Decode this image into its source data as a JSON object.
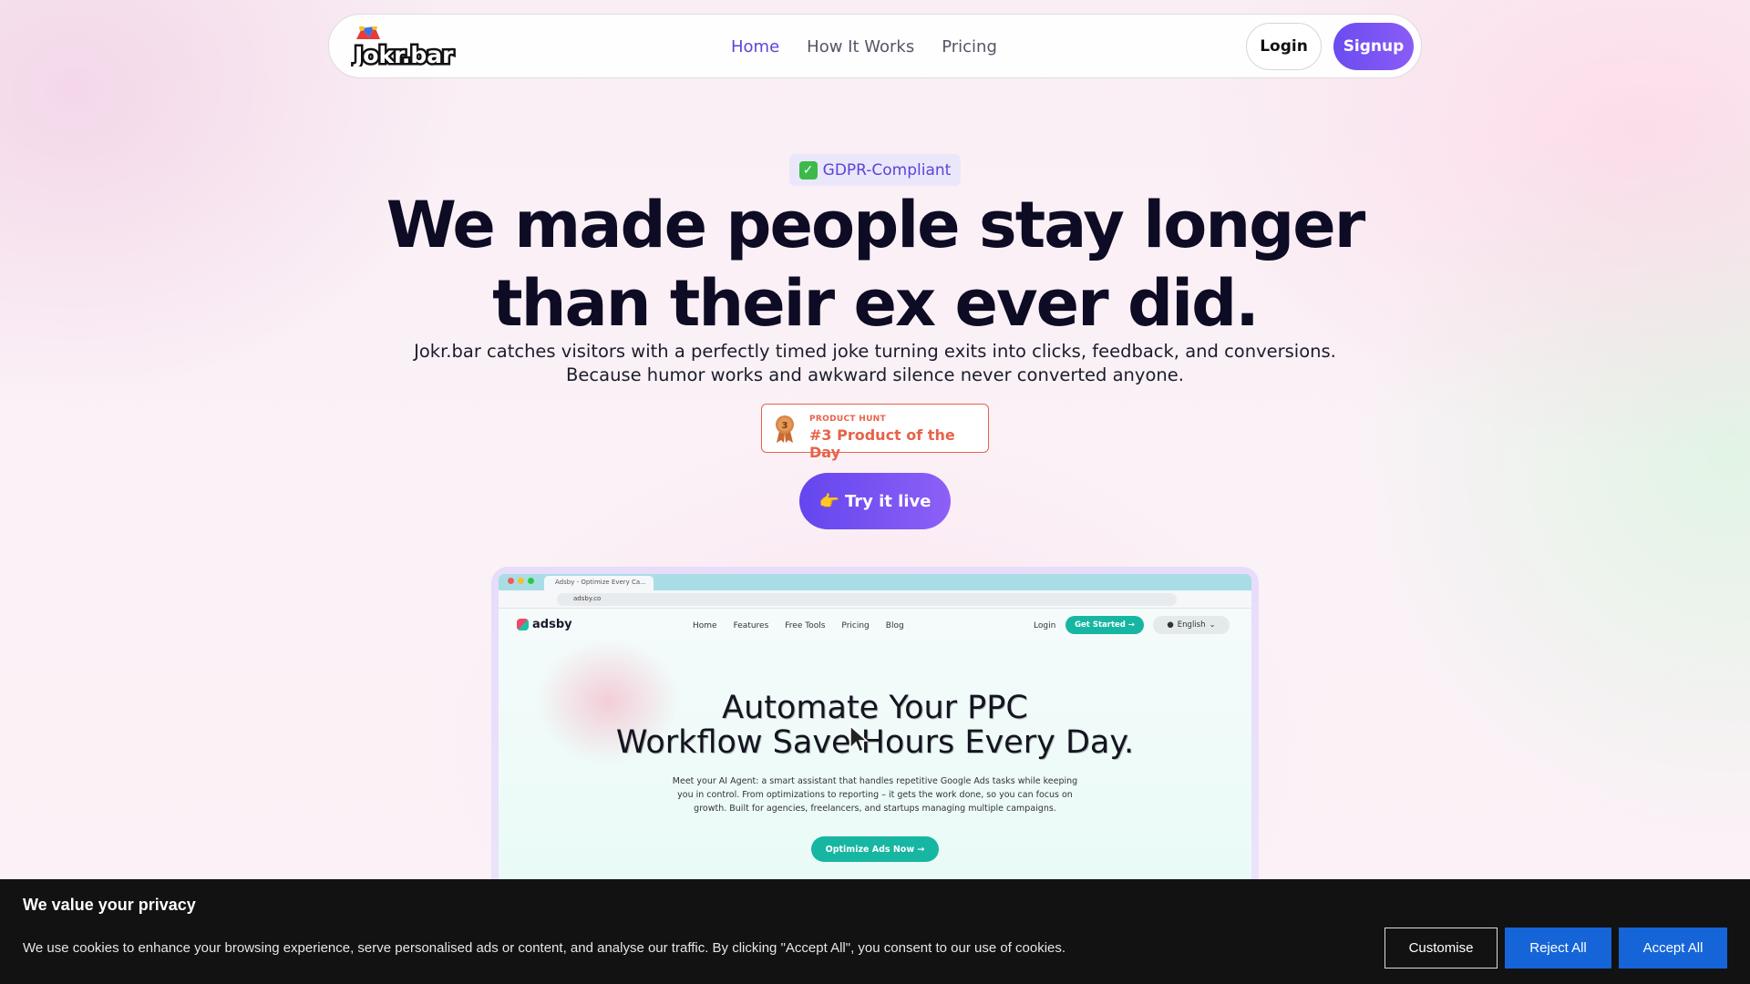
{
  "nav": {
    "logo_text": "Jokr.bar",
    "links": [
      "Home",
      "How It Works",
      "Pricing"
    ],
    "active": "Home",
    "login": "Login",
    "signup": "Signup"
  },
  "hero": {
    "badge": "GDPR-Compliant",
    "headline_line1": "We made people stay longer",
    "headline_line2": "than their ex ever did.",
    "sub_line1": "Jokr.bar catches visitors with a perfectly timed joke turning exits into clicks, feedback, and conversions.",
    "sub_line2": "Because humor works and awkward silence never converted anyone.",
    "product_hunt_small": "PRODUCT HUNT",
    "product_hunt_big": "#3 Product of the Day",
    "product_hunt_rank": "3",
    "cta_emoji": "👉",
    "cta": "Try it live"
  },
  "preview": {
    "tab_title": "Adsby - Optimize Every Ca...",
    "url": "adsby.co",
    "logo": "adsby",
    "links": [
      "Home",
      "Features",
      "Free Tools",
      "Pricing",
      "Blog"
    ],
    "login": "Login",
    "get_started": "Get Started →",
    "language": "English",
    "title_line1": "Automate Your PPC",
    "title_line2": "Workflow Save Hours Every Day.",
    "body": "Meet your AI Agent: a smart assistant that handles repetitive Google Ads tasks while keeping you in control. From optimizations to reporting – it gets the work done, so you can focus on growth. Built for agencies, freelancers, and startups managing multiple campaigns.",
    "cta": "Optimize Ads Now →"
  },
  "cookie": {
    "title": "We value your privacy",
    "text": "We use cookies to enhance your browsing experience, serve personalised ads or content, and analyse our traffic. By clicking \"Accept All\", you consent to our use of cookies.",
    "customise": "Customise",
    "reject": "Reject All",
    "accept": "Accept All"
  },
  "colors": {
    "accent": "#5b44d6",
    "signup_gradient_start": "#6b4cf0",
    "product_hunt": "#e8624a",
    "preview_teal": "#17b6a2",
    "cookie_bg": "#121212",
    "cookie_button": "#1565d8"
  }
}
